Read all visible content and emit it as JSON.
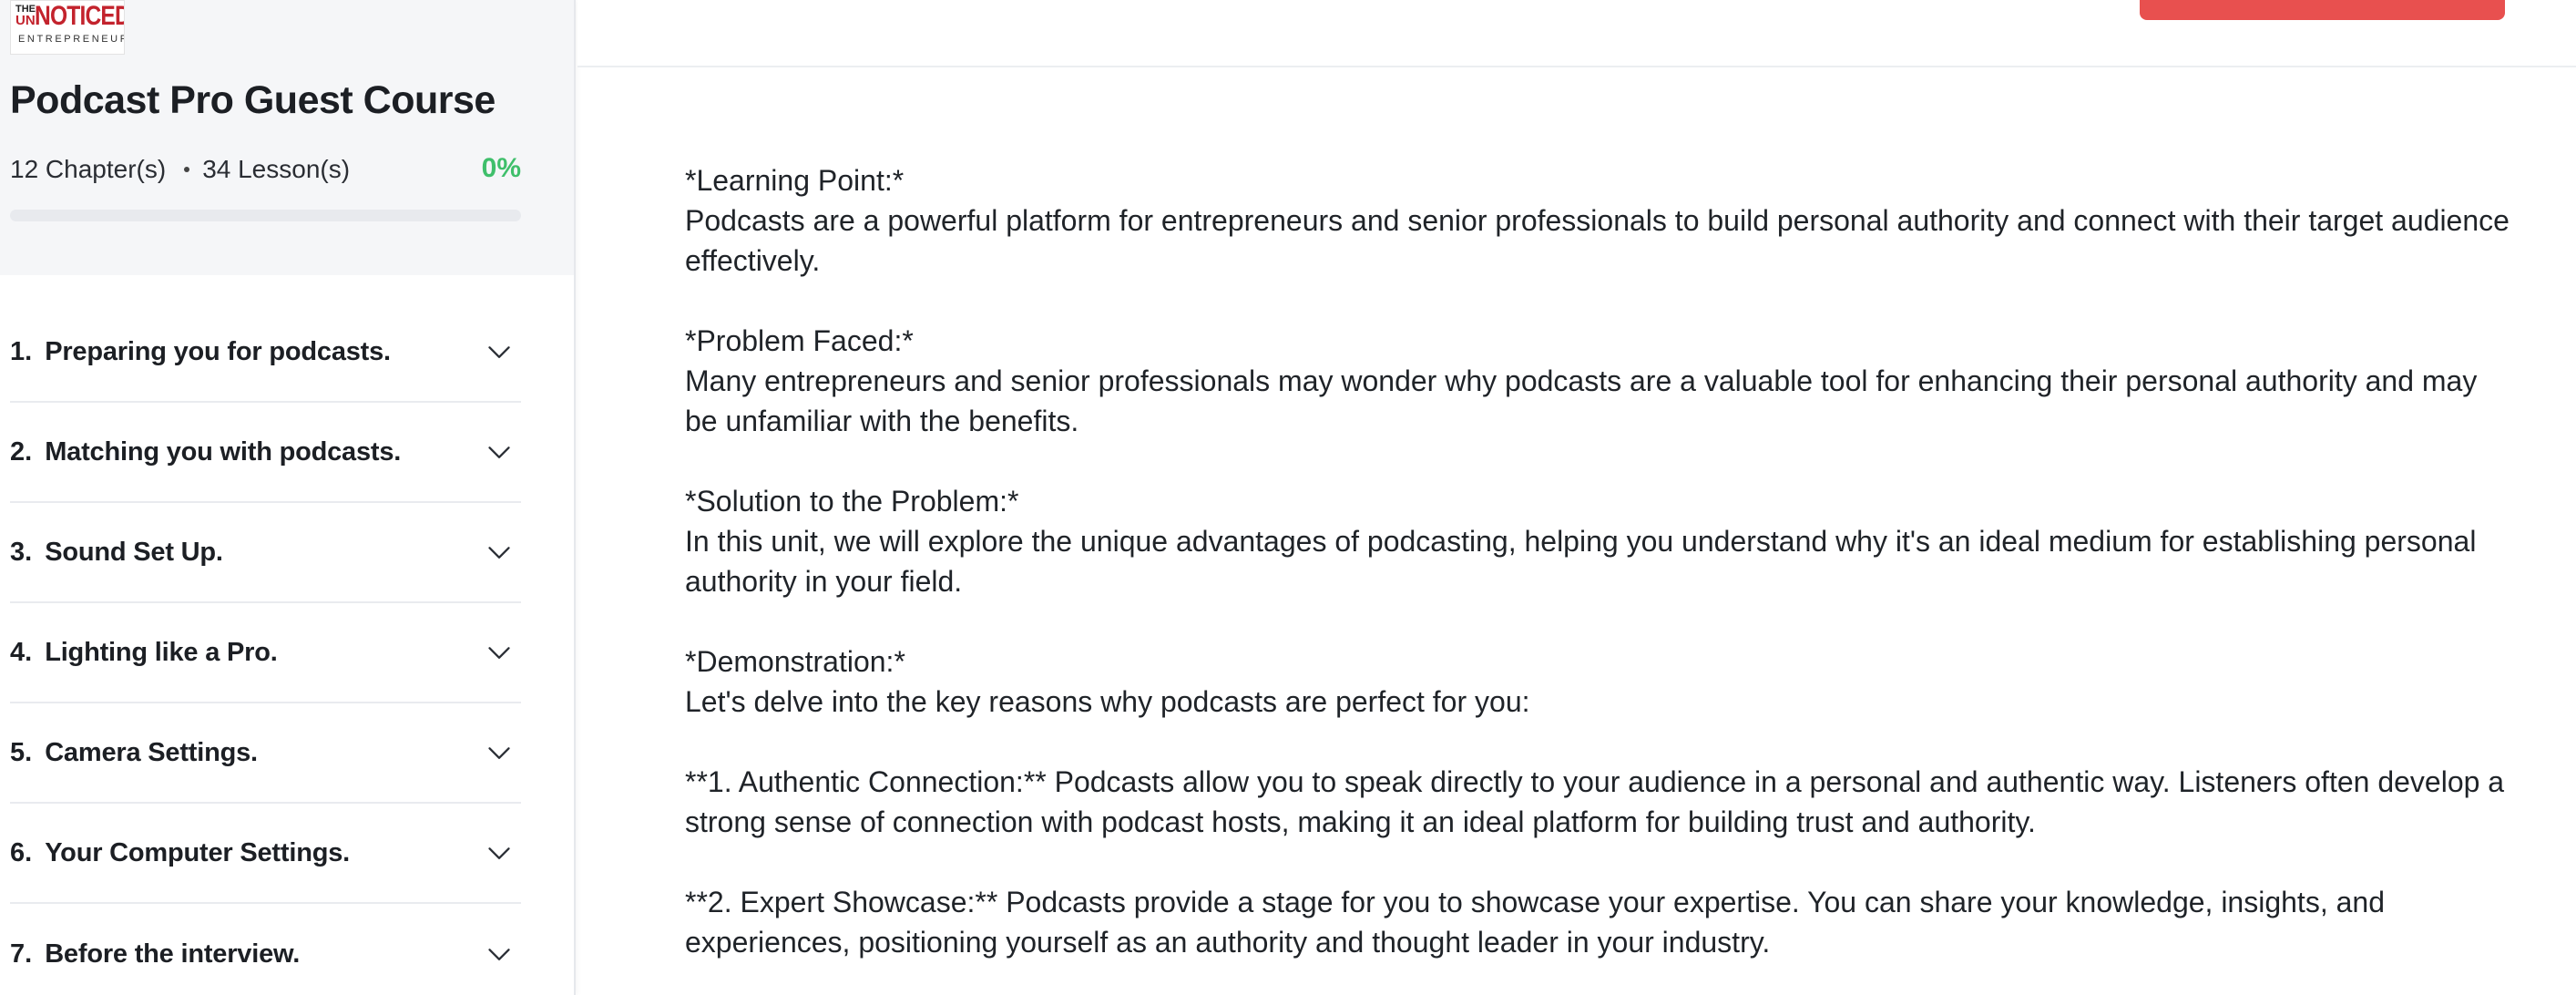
{
  "brand": {
    "logo_the": "THE",
    "logo_un": "UN",
    "logo_noticed": "NOTICED",
    "logo_entrepreneur": "ENTREPRENEUR",
    "logo_color": "#c3232d"
  },
  "course": {
    "title": "Podcast Pro Guest Course",
    "chapters_count": "12 Chapter(s)",
    "lessons_count": "34 Lesson(s)",
    "progress_label": "0%",
    "progress_value": 0,
    "accent_color": "#3fbf6b"
  },
  "chapters": [
    {
      "num": "1.",
      "title": "Preparing you for podcasts.",
      "icon": "chevron-down-icon"
    },
    {
      "num": "2.",
      "title": "Matching you with podcasts.",
      "icon": "chevron-down-icon"
    },
    {
      "num": "3.",
      "title": "Sound Set Up.",
      "icon": "chevron-down-icon"
    },
    {
      "num": "4.",
      "title": "Lighting like a Pro.",
      "icon": "chevron-down-icon"
    },
    {
      "num": "5.",
      "title": "Camera Settings.",
      "icon": "chevron-down-icon"
    },
    {
      "num": "6.",
      "title": "Your Computer Settings.",
      "icon": "chevron-down-icon"
    },
    {
      "num": "7.",
      "title": "Before the interview.",
      "icon": "chevron-down-icon"
    }
  ],
  "topbar": {
    "title": "",
    "button_label": "",
    "button_color": "#e8504f"
  },
  "lesson": {
    "sections": [
      {
        "heading": "*Learning Point:*",
        "body": "Podcasts are a powerful platform for entrepreneurs and senior professionals to build personal authority and connect with their target audience effectively."
      },
      {
        "heading": "*Problem Faced:*",
        "body": "Many entrepreneurs and senior professionals may wonder why podcasts are a valuable tool for enhancing their personal authority and may be unfamiliar with the benefits."
      },
      {
        "heading": "*Solution to the Problem:*",
        "body": "In this unit, we will explore the unique advantages of podcasting, helping you understand why it's an ideal medium for establishing personal authority in your field."
      },
      {
        "heading": "*Demonstration:*",
        "body": "Let's delve into the key reasons why podcasts are perfect for you:"
      },
      {
        "heading": "",
        "body": "**1. Authentic Connection:** Podcasts allow you to speak directly to your audience in a personal and authentic way. Listeners often develop a strong sense of connection with podcast hosts, making it an ideal platform for building trust and authority."
      },
      {
        "heading": "",
        "body": "**2. Expert Showcase:** Podcasts provide a stage for you to showcase your expertise. You can share your knowledge, insights, and experiences, positioning yourself as an authority and thought leader in your industry."
      }
    ]
  }
}
